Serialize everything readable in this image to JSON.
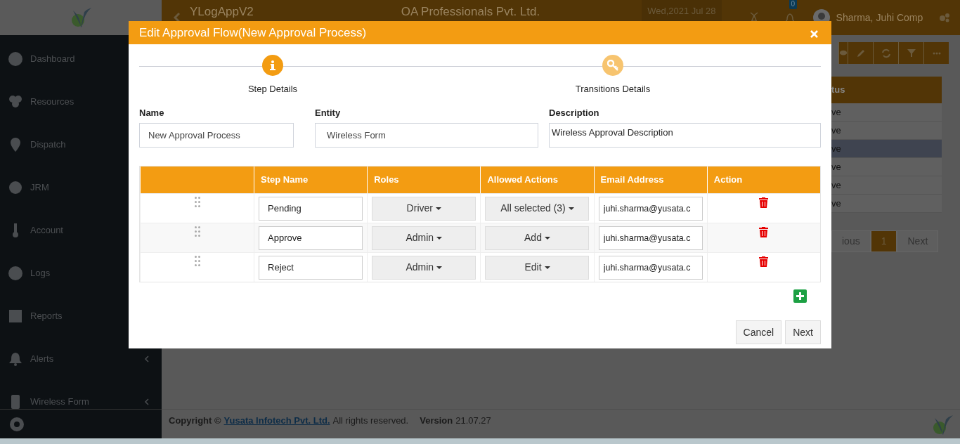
{
  "header": {
    "app_title": "YLogAppV2",
    "company": "OA Professionals Pvt. Ltd.",
    "date": "Wed,2021 Jul 28",
    "notification_count": "0",
    "user_name": "Sharma, Juhi Comp"
  },
  "sidebar": {
    "items": [
      {
        "label": "Dashboard"
      },
      {
        "label": "Resources"
      },
      {
        "label": "Dispatch"
      },
      {
        "label": "JRM"
      },
      {
        "label": "Account"
      },
      {
        "label": "Logs"
      },
      {
        "label": "Reports"
      },
      {
        "label": "Alerts",
        "expandable": true
      },
      {
        "label": "Wireless Form",
        "expandable": true
      }
    ]
  },
  "background_panel": {
    "column_header": "tus",
    "rows": [
      {
        "text": "ve",
        "selected": false
      },
      {
        "text": "ve",
        "selected": false
      },
      {
        "text": "ve",
        "selected": true
      },
      {
        "text": "ve",
        "selected": false
      },
      {
        "text": "ve",
        "selected": false
      },
      {
        "text": "ve",
        "selected": false
      }
    ],
    "pagination": [
      {
        "label": "ious",
        "selected": false
      },
      {
        "label": "1",
        "selected": true
      },
      {
        "label": "Next",
        "selected": false
      }
    ]
  },
  "footer": {
    "copyright": "Copyright ©",
    "company_link": "Yusata Infotech Pvt. Ltd.",
    "rights": "All rights reserved.",
    "version_label": "Version",
    "version": "21.07.27"
  },
  "modal": {
    "title": "Edit Approval Flow(New Approval Process)",
    "steps": [
      {
        "label": "Step Details",
        "selected": true
      },
      {
        "label": "Transitions Details",
        "selected": false
      }
    ],
    "fields": [
      {
        "kind": "input",
        "label": "Name",
        "value": "New Approval Process"
      },
      {
        "kind": "select",
        "label": "Entity",
        "value": "Wireless Form"
      },
      {
        "kind": "textarea",
        "label": "Description",
        "value": "Wireless Approval Description"
      }
    ],
    "table": {
      "columns": [
        "Step Name",
        "Roles",
        "Allowed Actions",
        "Email Address",
        "Action"
      ],
      "rows": [
        {
          "step_name": "Pending",
          "role": "Driver",
          "allowed_actions": "All selected (3)",
          "email": "juhi.sharma@yusata.c"
        },
        {
          "step_name": "Approve",
          "role": "Admin",
          "allowed_actions": "Add",
          "email": "juhi.sharma@yusata.c"
        },
        {
          "step_name": "Reject",
          "role": "Admin",
          "allowed_actions": "Edit",
          "email": "juhi.sharma@yusata.c"
        }
      ]
    },
    "buttons": [
      "Cancel",
      "Next"
    ]
  }
}
